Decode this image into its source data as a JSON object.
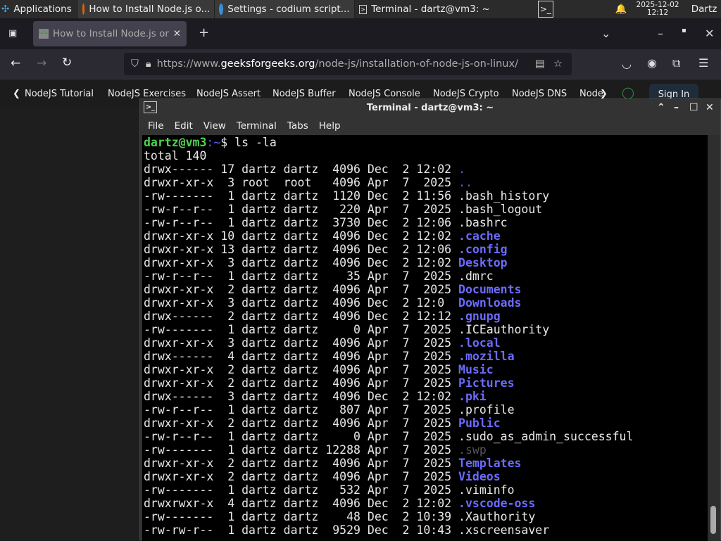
{
  "taskbar": {
    "apps_label": "Applications",
    "tasks": [
      "How to Install Node.js o...",
      "Settings - codium script...",
      "Terminal - dartz@vm3: ~"
    ],
    "date": "2025-12-02",
    "time": "12:12",
    "user": "Dartz"
  },
  "browser": {
    "tab_title": "How to Install Node.js or",
    "url_prefix": "https://www.",
    "url_domain": "geeksforgeeks.org",
    "url_path": "/node-js/installation-of-node-js-on-linux/",
    "bookmarks": [
      "NodeJS Tutorial",
      "NodeJS Exercises",
      "NodeJS Assert",
      "NodeJS Buffer",
      "NodeJS Console",
      "NodeJS Crypto",
      "NodeJS DNS",
      "Node"
    ],
    "sign_in": "Sign In"
  },
  "terminal": {
    "title": "Terminal - dartz@vm3: ~",
    "menu": [
      "File",
      "Edit",
      "View",
      "Terminal",
      "Tabs",
      "Help"
    ],
    "prompt_user": "dartz@vm3",
    "prompt_path": ":~",
    "prompt_symbol": "$ ",
    "command": "ls -la",
    "total": "total 140",
    "rows": [
      [
        "drwx------ 17 dartz dartz  4096 Dec  2 12:02 ",
        ".",
        "blue"
      ],
      [
        "drwxr-xr-x  3 root  root   4096 Apr  7  2025 ",
        "..",
        "blue"
      ],
      [
        "-rw-------  1 dartz dartz  1120 Dec  2 11:56 ",
        ".bash_history",
        ""
      ],
      [
        "-rw-r--r--  1 dartz dartz   220 Apr  7  2025 ",
        ".bash_logout",
        ""
      ],
      [
        "-rw-r--r--  1 dartz dartz  3730 Dec  2 12:06 ",
        ".bashrc",
        ""
      ],
      [
        "drwxr-xr-x 10 dartz dartz  4096 Dec  2 12:02 ",
        ".cache",
        "dir"
      ],
      [
        "drwxr-xr-x 13 dartz dartz  4096 Dec  2 12:06 ",
        ".config",
        "dir"
      ],
      [
        "drwxr-xr-x  3 dartz dartz  4096 Dec  2 12:02 ",
        "Desktop",
        "dir"
      ],
      [
        "-rw-r--r--  1 dartz dartz    35 Apr  7  2025 ",
        ".dmrc",
        ""
      ],
      [
        "drwxr-xr-x  2 dartz dartz  4096 Apr  7  2025 ",
        "Documents",
        "dir"
      ],
      [
        "drwxr-xr-x  3 dartz dartz  4096 Dec  2 12:0  ",
        "Downloads",
        "dir"
      ],
      [
        "drwx------  2 dartz dartz  4096 Dec  2 12:12 ",
        ".gnupg",
        "dir"
      ],
      [
        "-rw-------  1 dartz dartz     0 Apr  7  2025 ",
        ".ICEauthority",
        ""
      ],
      [
        "drwxr-xr-x  3 dartz dartz  4096 Apr  7  2025 ",
        ".local",
        "dir"
      ],
      [
        "drwx------  4 dartz dartz  4096 Apr  7  2025 ",
        ".mozilla",
        "dir"
      ],
      [
        "drwxr-xr-x  2 dartz dartz  4096 Apr  7  2025 ",
        "Music",
        "dir"
      ],
      [
        "drwxr-xr-x  2 dartz dartz  4096 Apr  7  2025 ",
        "Pictures",
        "dir"
      ],
      [
        "drwx------  3 dartz dartz  4096 Dec  2 12:02 ",
        ".pki",
        "dir"
      ],
      [
        "-rw-r--r--  1 dartz dartz   807 Apr  7  2025 ",
        ".profile",
        ""
      ],
      [
        "drwxr-xr-x  2 dartz dartz  4096 Apr  7  2025 ",
        "Public",
        "dir"
      ],
      [
        "-rw-r--r--  1 dartz dartz     0 Apr  7  2025 ",
        ".sudo_as_admin_successful",
        ""
      ],
      [
        "-rw-------  1 dartz dartz 12288 Apr  7  2025 ",
        ".swp",
        "dim"
      ],
      [
        "drwxr-xr-x  2 dartz dartz  4096 Apr  7  2025 ",
        "Templates",
        "dir"
      ],
      [
        "drwxr-xr-x  2 dartz dartz  4096 Apr  7  2025 ",
        "Videos",
        "dir"
      ],
      [
        "-rw-------  1 dartz dartz   532 Apr  7  2025 ",
        ".viminfo",
        ""
      ],
      [
        "drwxrwxr-x  4 dartz dartz  4096 Dec  2 12:02 ",
        ".vscode-oss",
        "dir"
      ],
      [
        "-rw-------  1 dartz dartz    48 Dec  2 10:39 ",
        ".Xauthority",
        ""
      ],
      [
        "-rw-rw-r--  1 dartz dartz  9529 Dec  2 10:43 ",
        ".xscreensaver",
        ""
      ]
    ]
  }
}
